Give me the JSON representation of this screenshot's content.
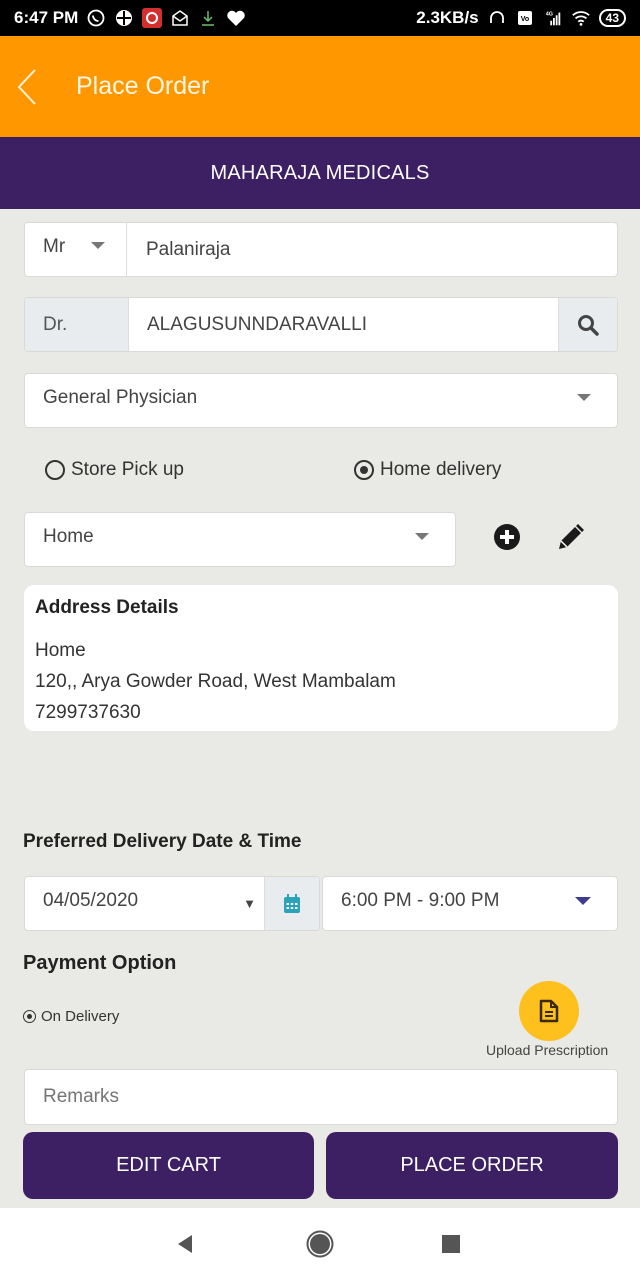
{
  "status_bar": {
    "time": "6:47 PM",
    "net_speed": "2.3KB/s",
    "network": "4G",
    "battery": "43",
    "left_icons": [
      "whatsapp-icon",
      "app-icon",
      "vodafone-icon",
      "mail-icon",
      "download-icon",
      "health-icon"
    ],
    "right_icons": [
      "headset-icon",
      "volte-icon",
      "signal-icon",
      "wifi-icon",
      "battery-icon"
    ]
  },
  "app_bar": {
    "title": "Place Order",
    "back_icon": "chevron-left-icon"
  },
  "store": {
    "name": "MAHARAJA MEDICALS"
  },
  "patient": {
    "salutation": "Mr",
    "name": "Palaniraja"
  },
  "doctor": {
    "prefix": "Dr.",
    "name": "ALAGUSUNNDARAVALLI",
    "search_icon": "search-icon"
  },
  "specialty": {
    "selected": "General Physician"
  },
  "delivery_mode": {
    "options": [
      {
        "label": "Store Pick up",
        "selected": false
      },
      {
        "label": "Home delivery",
        "selected": true
      }
    ]
  },
  "address_select": {
    "selected": "Home",
    "add_icon": "plus-circle-icon",
    "edit_icon": "pencil-icon"
  },
  "address_details": {
    "heading": "Address Details",
    "label": "Home",
    "street": "120,, Arya Gowder Road, West Mambalam",
    "phone": "7299737630"
  },
  "delivery_time": {
    "heading": "Preferred Delivery Date & Time",
    "date": "04/05/2020",
    "time_slot": "6:00 PM - 9:00 PM"
  },
  "payment": {
    "heading": "Payment Option",
    "option": "On Delivery",
    "selected": true
  },
  "upload": {
    "label": "Upload Prescription"
  },
  "remarks": {
    "placeholder": "Remarks",
    "value": ""
  },
  "actions": {
    "edit_cart": "EDIT CART",
    "place_order": "PLACE ORDER"
  },
  "colors": {
    "app_bar": "#ff9800",
    "brand_purple": "#3d2063",
    "upload_yellow": "#fdc01c",
    "calendar_teal": "#2aa3b8",
    "time_caret": "#3f3d8f"
  }
}
